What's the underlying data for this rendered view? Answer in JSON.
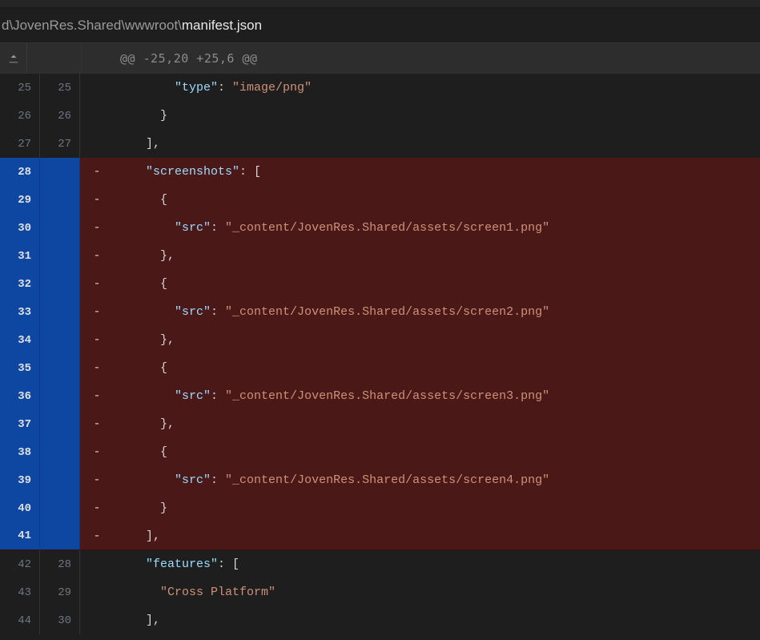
{
  "file": {
    "path_prefix": "d\\JovenRes.Shared\\wwwroot\\",
    "filename": "manifest.json"
  },
  "hunk": {
    "header": "@@ -25,20 +25,6 @@"
  },
  "rows": [
    {
      "type": "ctx",
      "l": "25",
      "r": "25",
      "indent": 4,
      "segs": [
        {
          "t": "\"type\"",
          "c": "key"
        },
        {
          "t": ": ",
          "c": "punct"
        },
        {
          "t": "\"image/png\"",
          "c": "str"
        }
      ]
    },
    {
      "type": "ctx",
      "l": "26",
      "r": "26",
      "indent": 3,
      "segs": [
        {
          "t": "}",
          "c": "punct"
        }
      ]
    },
    {
      "type": "ctx",
      "l": "27",
      "r": "27",
      "indent": 2,
      "segs": [
        {
          "t": "],",
          "c": "punct"
        }
      ]
    },
    {
      "type": "del",
      "l": "28",
      "r": "",
      "indent": 2,
      "segs": [
        {
          "t": "\"screenshots\"",
          "c": "key"
        },
        {
          "t": ": [",
          "c": "punct"
        }
      ]
    },
    {
      "type": "del",
      "l": "29",
      "r": "",
      "indent": 3,
      "segs": [
        {
          "t": "{",
          "c": "punct"
        }
      ]
    },
    {
      "type": "del",
      "l": "30",
      "r": "",
      "indent": 4,
      "segs": [
        {
          "t": "\"src\"",
          "c": "key"
        },
        {
          "t": ": ",
          "c": "punct"
        },
        {
          "t": "\"_content/JovenRes.Shared/assets/screen1.png\"",
          "c": "str"
        }
      ]
    },
    {
      "type": "del",
      "l": "31",
      "r": "",
      "indent": 3,
      "segs": [
        {
          "t": "},",
          "c": "punct"
        }
      ]
    },
    {
      "type": "del",
      "l": "32",
      "r": "",
      "indent": 3,
      "segs": [
        {
          "t": "{",
          "c": "punct"
        }
      ]
    },
    {
      "type": "del",
      "l": "33",
      "r": "",
      "indent": 4,
      "segs": [
        {
          "t": "\"src\"",
          "c": "key"
        },
        {
          "t": ": ",
          "c": "punct"
        },
        {
          "t": "\"_content/JovenRes.Shared/assets/screen2.png\"",
          "c": "str"
        }
      ]
    },
    {
      "type": "del",
      "l": "34",
      "r": "",
      "indent": 3,
      "segs": [
        {
          "t": "},",
          "c": "punct"
        }
      ]
    },
    {
      "type": "del",
      "l": "35",
      "r": "",
      "indent": 3,
      "segs": [
        {
          "t": "{",
          "c": "punct"
        }
      ]
    },
    {
      "type": "del",
      "l": "36",
      "r": "",
      "indent": 4,
      "segs": [
        {
          "t": "\"src\"",
          "c": "key"
        },
        {
          "t": ": ",
          "c": "punct"
        },
        {
          "t": "\"_content/JovenRes.Shared/assets/screen3.png\"",
          "c": "str"
        }
      ]
    },
    {
      "type": "del",
      "l": "37",
      "r": "",
      "indent": 3,
      "segs": [
        {
          "t": "},",
          "c": "punct"
        }
      ]
    },
    {
      "type": "del",
      "l": "38",
      "r": "",
      "indent": 3,
      "segs": [
        {
          "t": "{",
          "c": "punct"
        }
      ]
    },
    {
      "type": "del",
      "l": "39",
      "r": "",
      "indent": 4,
      "segs": [
        {
          "t": "\"src\"",
          "c": "key"
        },
        {
          "t": ": ",
          "c": "punct"
        },
        {
          "t": "\"_content/JovenRes.Shared/assets/screen4.png\"",
          "c": "str"
        }
      ]
    },
    {
      "type": "del",
      "l": "40",
      "r": "",
      "indent": 3,
      "segs": [
        {
          "t": "}",
          "c": "punct"
        }
      ]
    },
    {
      "type": "del",
      "l": "41",
      "r": "",
      "indent": 2,
      "last": true,
      "segs": [
        {
          "t": "],",
          "c": "punct"
        }
      ]
    },
    {
      "type": "ctx",
      "l": "42",
      "r": "28",
      "indent": 2,
      "segs": [
        {
          "t": "\"features\"",
          "c": "key"
        },
        {
          "t": ": [",
          "c": "punct"
        }
      ]
    },
    {
      "type": "ctx",
      "l": "43",
      "r": "29",
      "indent": 3,
      "segs": [
        {
          "t": "\"Cross Platform\"",
          "c": "str"
        }
      ]
    },
    {
      "type": "ctx",
      "l": "44",
      "r": "30",
      "indent": 2,
      "segs": [
        {
          "t": "],",
          "c": "punct"
        }
      ]
    }
  ]
}
